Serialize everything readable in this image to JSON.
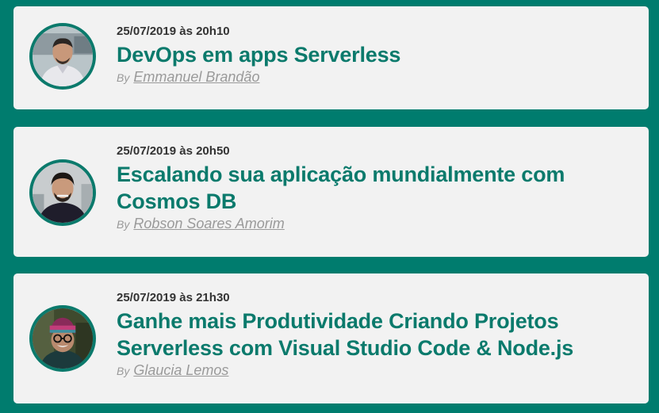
{
  "sessions": [
    {
      "date": "25/07/2019 às 20h10",
      "title": "DevOps em apps Serverless",
      "by_label": "By",
      "author": "Emmanuel Brandão",
      "avatar_icon": "speaker-avatar"
    },
    {
      "date": "25/07/2019 às 20h50",
      "title": "Escalando sua aplicação mundialmente com Cosmos DB",
      "by_label": "By",
      "author": "Robson Soares Amorim",
      "avatar_icon": "speaker-avatar"
    },
    {
      "date": "25/07/2019 às 21h30",
      "title": "Ganhe mais Produtividade Criando Projetos Serverless com Visual Studio Code & Node.js",
      "by_label": "By",
      "author": "Glaucia Lemos",
      "avatar_icon": "speaker-avatar"
    }
  ],
  "colors": {
    "background": "#007c6e",
    "card": "#f2f2f2",
    "title": "#0b7a6c",
    "date": "#333333",
    "author": "#9a9a9a"
  }
}
